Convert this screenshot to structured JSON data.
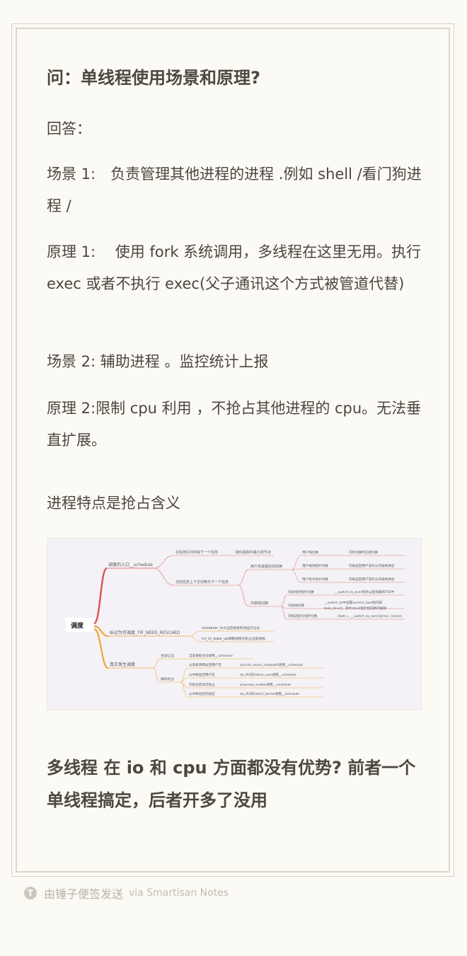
{
  "heading": "问：单线程使用场景和原理?",
  "paragraphs": [
    "回答：",
    "场景 1:　负责管理其他进程的进程 .例如 shell /看门狗进程 /",
    "原理 1:　 使用 fork 系统调用，多线程在这里无用。执行 exec 或者不执行 exec(父子通讯这个方式被管道代替)",
    "场景 2: 辅助进程 。监控统计上报",
    "原理 2:限制 cpu 利用 ，不抢占其他进程的 cpu。无法垂直扩展。",
    "进程特点是抢占含义"
  ],
  "mindmap": {
    "root": "调度",
    "branches": [
      {
        "label": "调度的入口__schedule",
        "color": "#d9534f",
        "items": [
          {
            "label": "在任务队列中取下一个任务",
            "detail": "取红黑树中最小的节点"
          },
          {
            "label": "当前任务上下文切换为下一个任务",
            "children": [
              {
                "label": "用户态进程空间切换",
                "leaves": [
                  {
                    "label": "用户栈切换",
                    "detail": "内存切换时已经切换"
                  },
                  {
                    "label": "用户栈顶指针切换",
                    "detail": "内核返回用户态时从内核栈弹出"
                  },
                  {
                    "label": "用户指令指针切换",
                    "detail": "内核返回用户态时从内核栈弹出"
                  }
                ]
              },
              {
                "label": "内核栈切换",
                "leaves": [
                  {
                    "label": "内核栈顶指针切换",
                    "detail": "__switch_to_asm修改sp后加载到TSS中"
                  },
                  {
                    "label": "内核栈切换",
                    "detail": "__switch_to中设置current_task指向新task_struct，其中stack指针指向新内核栈"
                  },
                  {
                    "label": "内核态指令指针切换",
                    "detail": "(last) = __switch_to_asm((prev), (next))"
                  }
                ]
              }
            ]
          }
        ]
      },
      {
        "label": "标记为可调度_TIF_NEED_RESCHED",
        "color": "#f0a33a",
        "items": [
          {
            "label": "scheduler_tick当前进程时间运行过长"
          },
          {
            "label": "try_to_wake_up唤醒进程可抢占当前进程"
          }
        ]
      },
      {
        "label": "真正发生调度",
        "color": "#f0a33a",
        "items": [
          {
            "label": "主动让出",
            "leaves": [
              {
                "label": "当前进程主动调用__schedule"
              }
            ]
          },
          {
            "label": "被动抢占",
            "leaves": [
              {
                "label": "从系统调用返回用户态",
                "detail": "syscall_return_slowpath调用__schedule"
              },
              {
                "label": "从中断返回用户态",
                "detail": "do_IRQ的retint_user调用__schedule"
              },
              {
                "label": "内核态启动可抢占",
                "detail": "preempt_enable调用__schedule"
              },
              {
                "label": "从中断返回内核态",
                "detail": "do_IRQ的retint_kernel调用__schedule"
              }
            ]
          }
        ]
      }
    ]
  },
  "bottom_heading": "多线程 在 io 和 cpu 方面都没有优势? 前者一个单线程搞定，后者开多了没用",
  "footer": {
    "logo": "T",
    "text": "由锤子便签发送",
    "via": "via Smartisan Notes"
  }
}
